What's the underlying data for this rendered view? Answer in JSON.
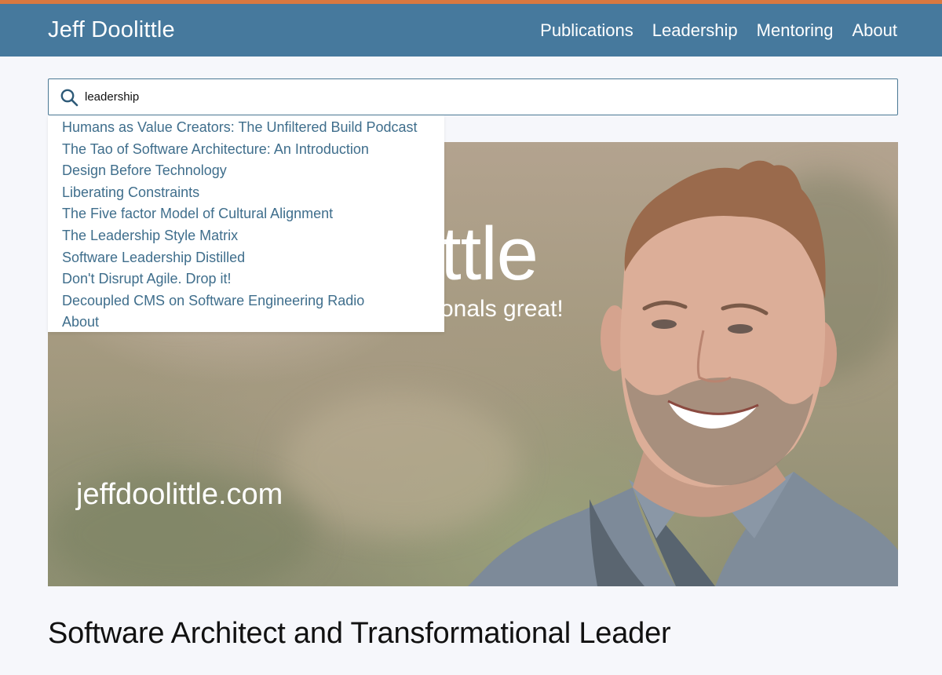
{
  "header": {
    "site_title": "Jeff Doolittle",
    "nav": [
      {
        "label": "Publications"
      },
      {
        "label": "Leadership"
      },
      {
        "label": "Mentoring"
      },
      {
        "label": "About"
      }
    ]
  },
  "search": {
    "value": "leadership",
    "icon": "search-icon"
  },
  "dropdown": {
    "results": [
      {
        "label": "Humans as Value Creators: The Unfiltered Build Podcast"
      },
      {
        "label": "The Tao of Software Architecture: An Introduction"
      },
      {
        "label": "Design Before Technology"
      },
      {
        "label": "Liberating Constraints"
      },
      {
        "label": "The Five factor Model of Cultural Alignment"
      },
      {
        "label": "The Leadership Style Matrix"
      },
      {
        "label": "Software Leadership Distilled"
      },
      {
        "label": "Don't Disrupt Agile. Drop it!"
      },
      {
        "label": "Decoupled CMS on Software Engineering Radio"
      },
      {
        "label": "About"
      }
    ]
  },
  "hero": {
    "title_fragment": "ttle",
    "tagline_fragment": "onals great!",
    "domain": "jeffdoolittle.com"
  },
  "main": {
    "heading": "Software Architect and Transformational Leader"
  },
  "colors": {
    "accent_bar": "#d9783f",
    "header_bg": "#46799d",
    "link": "#3f6e8c",
    "page_bg": "#f6f7fb"
  }
}
